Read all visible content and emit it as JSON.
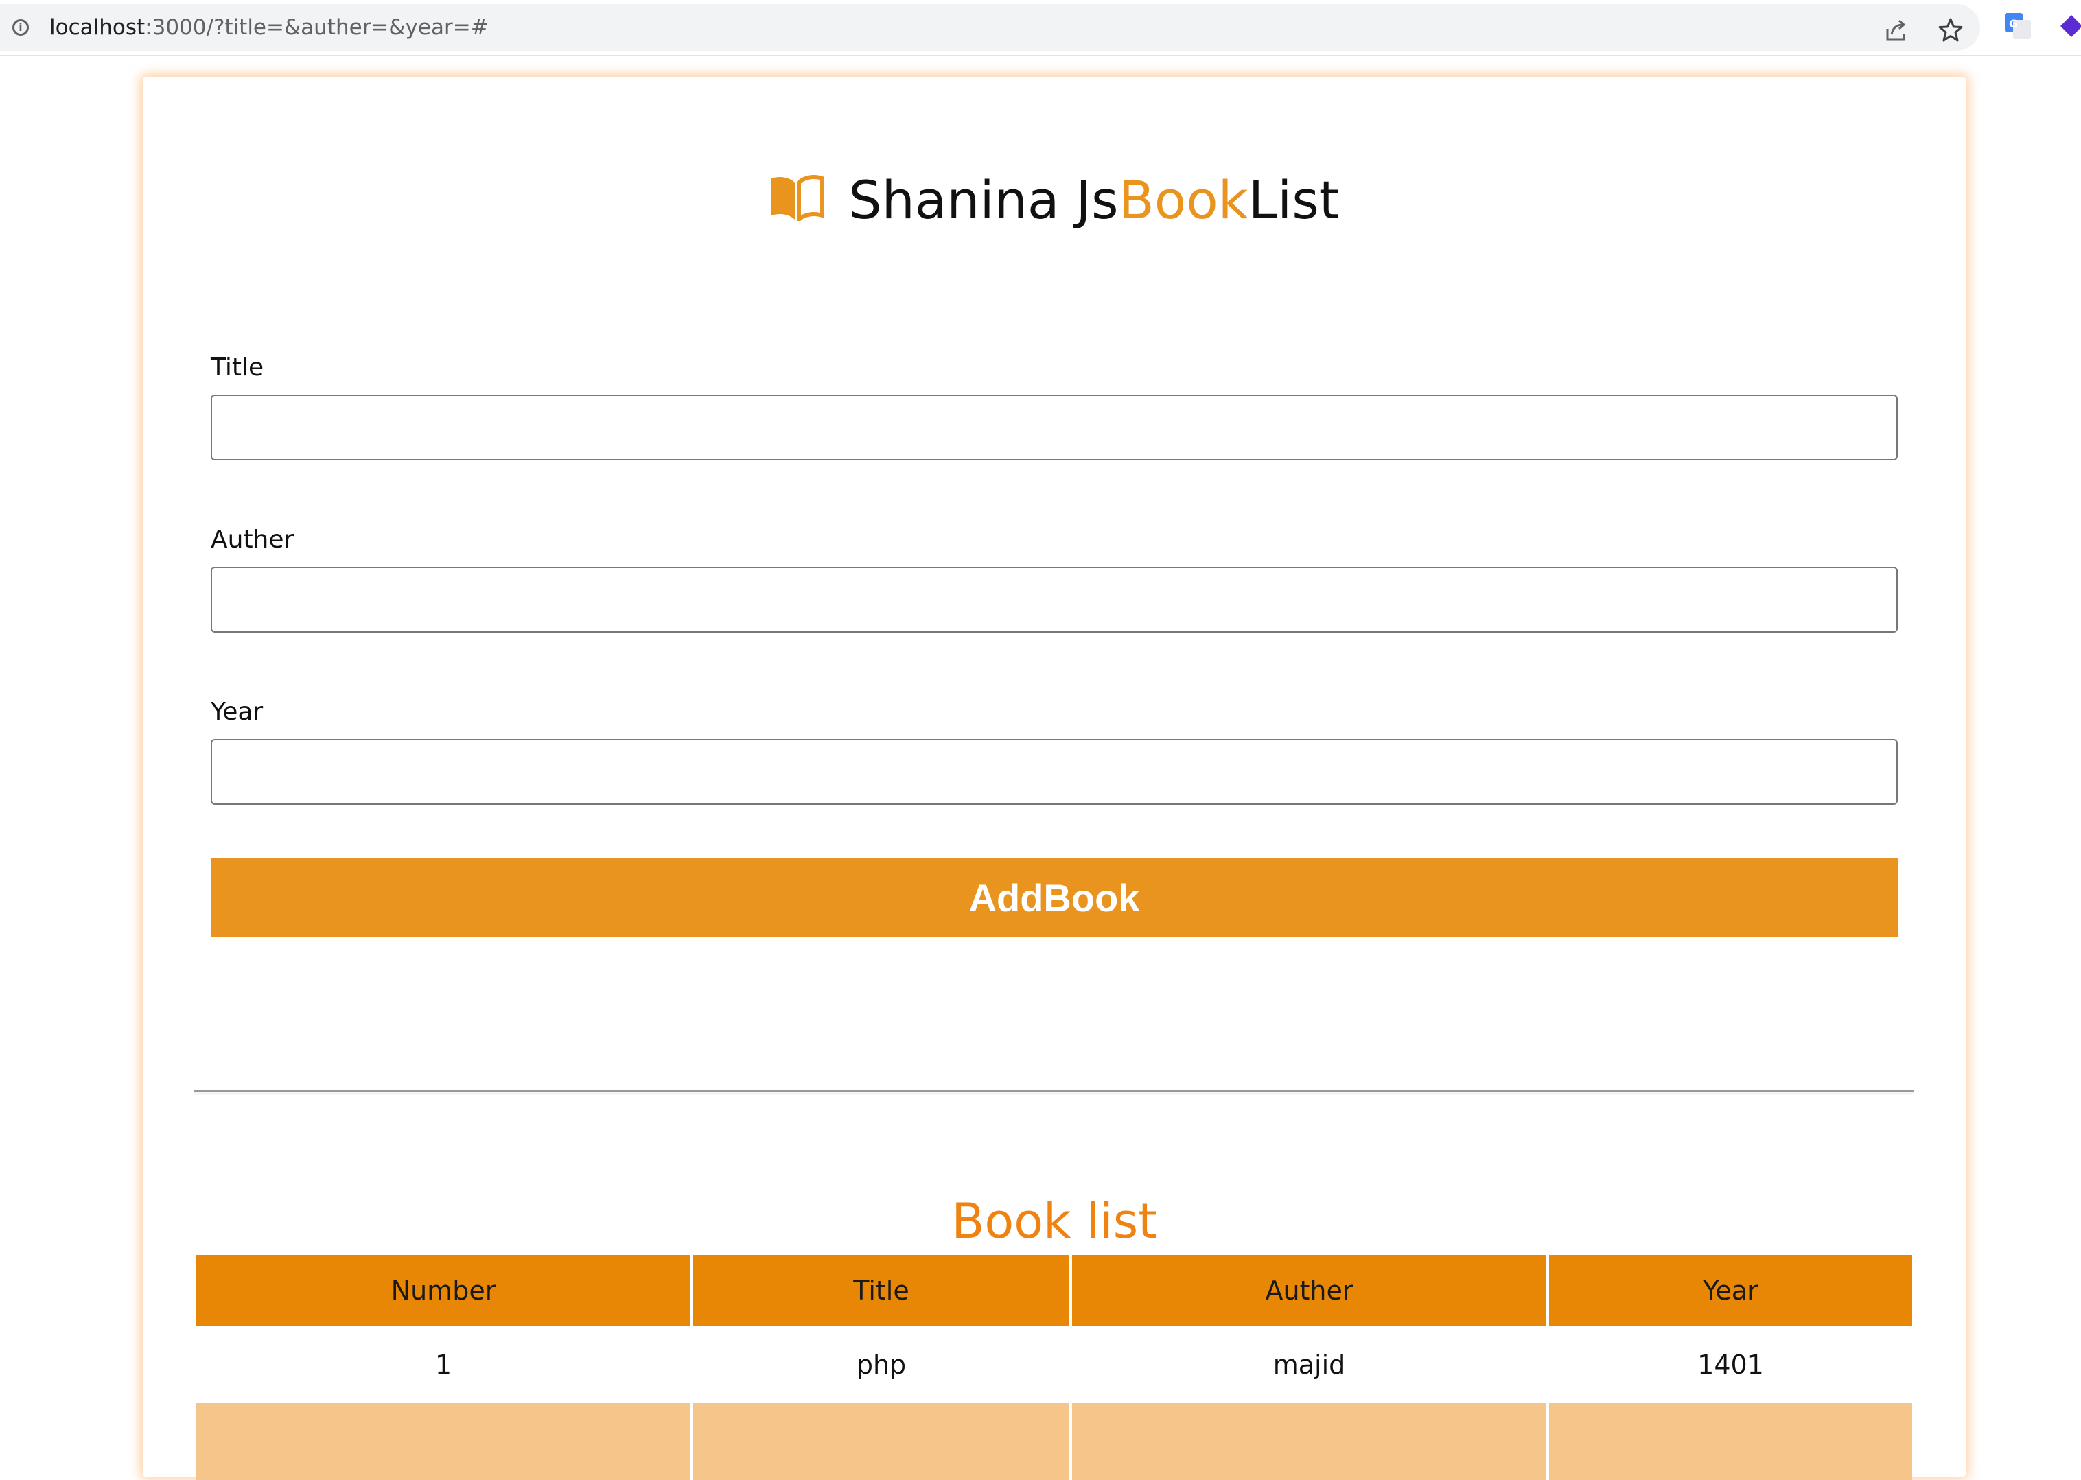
{
  "browser": {
    "url_host": "localhost",
    "url_rest": ":3000/?title=&auther=&year=#"
  },
  "header": {
    "brand_prefix": "Shanina Js",
    "brand_accent": "Book",
    "brand_suffix": "List",
    "icon": "open-book-icon"
  },
  "form": {
    "title_label": "Title",
    "title_value": "",
    "auther_label": "Auther",
    "auther_value": "",
    "year_label": "Year",
    "year_value": "",
    "submit_label": "AddBook"
  },
  "book_list": {
    "heading": "Book list",
    "columns": [
      "Number",
      "Title",
      "Auther",
      "Year"
    ],
    "rows": [
      {
        "number": "1",
        "title": "php",
        "auther": "majid",
        "year": "1401"
      },
      {
        "number": "",
        "title": "",
        "auther": "",
        "year": ""
      }
    ]
  },
  "colors": {
    "accent": "#e8941f",
    "table_header": "#e88705",
    "heading": "#ee8312",
    "row_alt": "#f5c58a"
  }
}
